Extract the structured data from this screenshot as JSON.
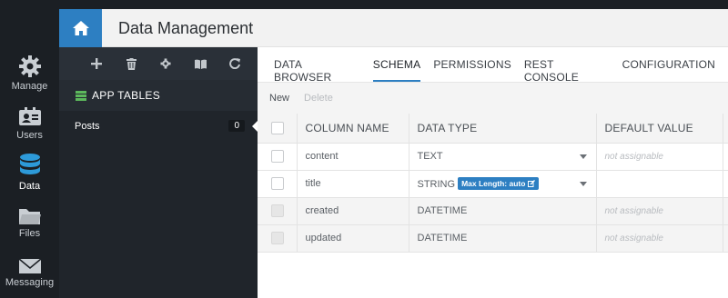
{
  "app": {
    "title": "Data Management"
  },
  "rail": {
    "items": [
      {
        "label": "Manage",
        "icon": "gear-icon"
      },
      {
        "label": "Users",
        "icon": "users-icon"
      },
      {
        "label": "Data",
        "icon": "database-icon",
        "active": true
      },
      {
        "label": "Files",
        "icon": "folder-icon"
      },
      {
        "label": "Messaging",
        "icon": "envelope-icon"
      }
    ]
  },
  "sidebar": {
    "toolbar": [
      "add-icon",
      "trash-icon",
      "gear-icon",
      "book-icon",
      "refresh-icon"
    ],
    "section_label": "APP TABLES",
    "tables": [
      {
        "name": "Posts",
        "count": "0"
      }
    ]
  },
  "tabs": [
    {
      "label": "DATA BROWSER"
    },
    {
      "label": "SCHEMA",
      "active": true
    },
    {
      "label": "PERMISSIONS"
    },
    {
      "label": "REST CONSOLE"
    },
    {
      "label": "CONFIGURATION"
    }
  ],
  "actions": {
    "new_label": "New",
    "delete_label": "Delete"
  },
  "table": {
    "headers": {
      "name": "COLUMN NAME",
      "type": "DATA TYPE",
      "default": "DEFAULT VALUE"
    },
    "rows": [
      {
        "name": "content",
        "type": "TEXT",
        "default": "not assignable",
        "badge": ""
      },
      {
        "name": "title",
        "type": "STRING",
        "default": "",
        "badge": "Max Length: auto"
      },
      {
        "name": "created",
        "type": "DATETIME",
        "default": "not assignable",
        "badge": ""
      },
      {
        "name": "updated",
        "type": "DATETIME",
        "default": "not assignable",
        "badge": ""
      }
    ]
  },
  "colors": {
    "accent": "#2d7fc2",
    "rail_bg": "#1b1f24",
    "panel_bg": "#20252b"
  }
}
